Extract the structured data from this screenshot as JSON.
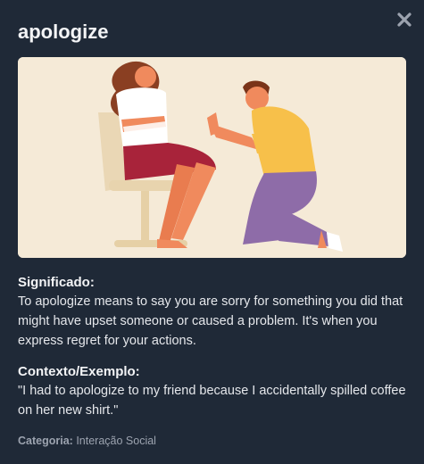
{
  "header": {
    "title": "apologize"
  },
  "icons": {
    "close": "close-icon"
  },
  "illustration": {
    "icon": "apology-illustration",
    "colors": {
      "background": "#f5ead7",
      "shirt_yellow": "#f7c04a",
      "pants_purple": "#8e6ca8",
      "skirt_red": "#a8233a",
      "hair_brown": "#8a3f22",
      "skin": "#f08a5d"
    }
  },
  "meaning": {
    "label": "Significado:",
    "text": "To apologize means to say you are sorry for something you did that might have upset someone or caused a problem. It's when you express regret for your actions."
  },
  "example": {
    "label": "Contexto/Exemplo:",
    "text": "\"I had to apologize to my friend because I accidentally spilled coffee on her new shirt.\""
  },
  "category": {
    "label": "Categoria:",
    "value": "Interação Social"
  }
}
